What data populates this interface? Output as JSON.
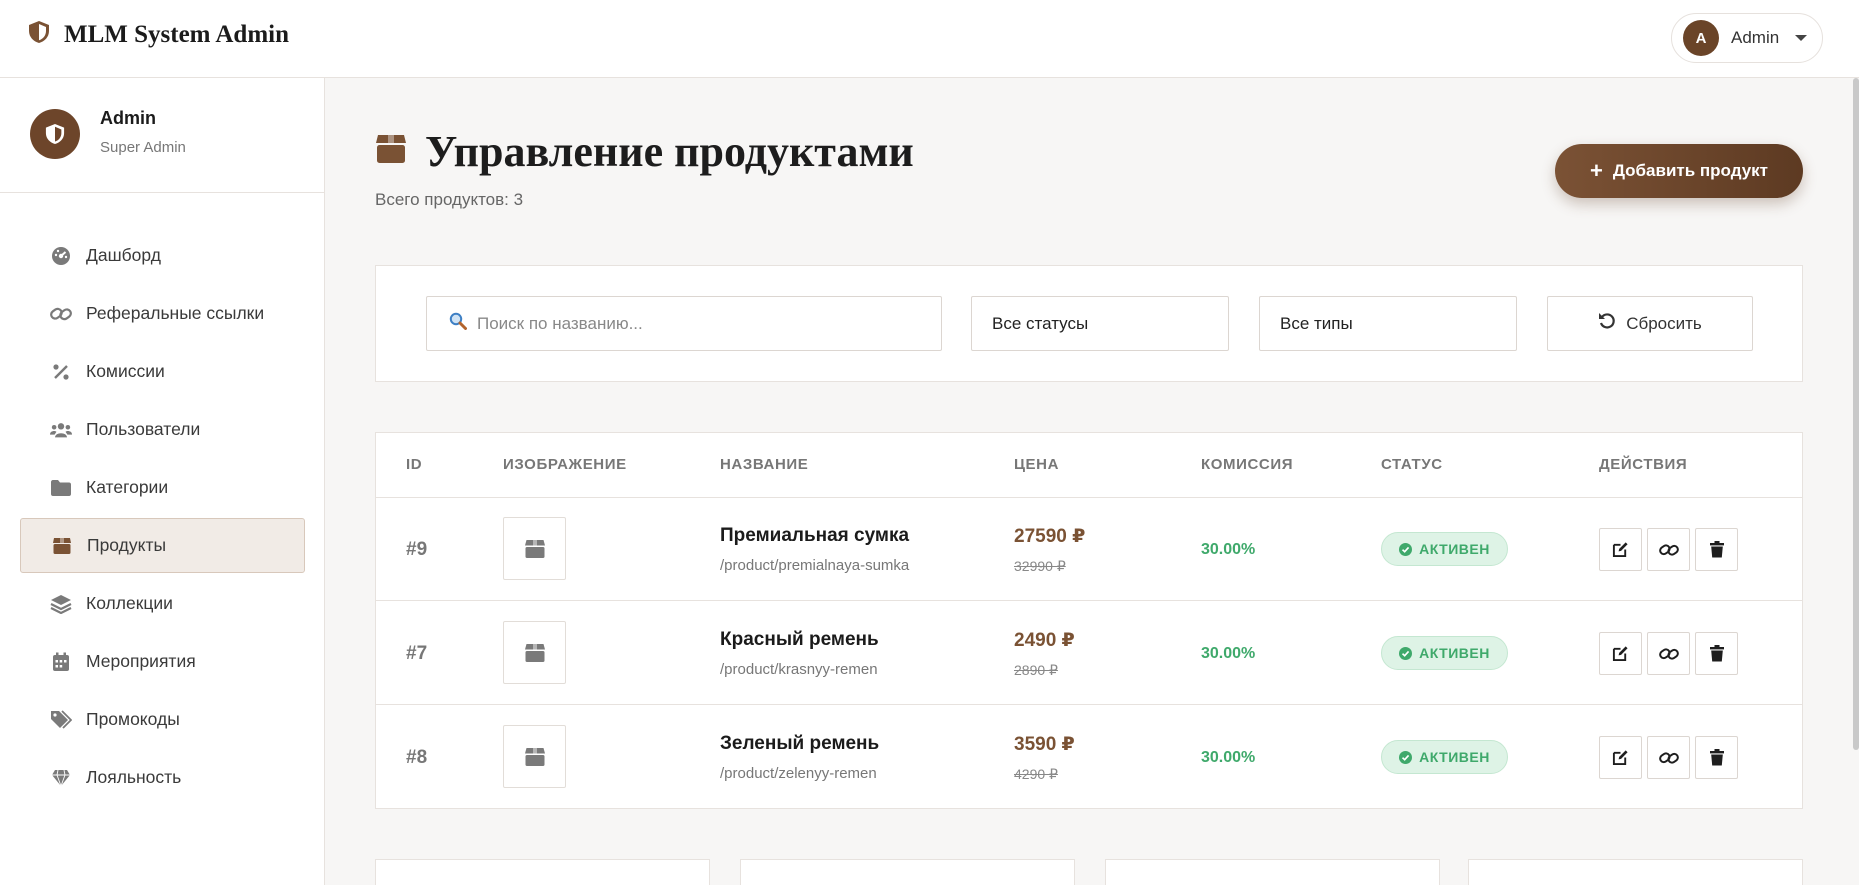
{
  "app": {
    "title": "MLM System Admin"
  },
  "header": {
    "user_initial": "A",
    "user_name": "Admin"
  },
  "sidebar": {
    "profile": {
      "name": "Admin",
      "role": "Super Admin"
    },
    "items": [
      {
        "label": "Дашборд",
        "icon": "dashboard-icon",
        "active": false
      },
      {
        "label": "Реферальные ссылки",
        "icon": "link-icon",
        "active": false
      },
      {
        "label": "Комиссии",
        "icon": "percent-icon",
        "active": false
      },
      {
        "label": "Пользователи",
        "icon": "users-icon",
        "active": false
      },
      {
        "label": "Категории",
        "icon": "folder-icon",
        "active": false
      },
      {
        "label": "Продукты",
        "icon": "box-icon",
        "active": true
      },
      {
        "label": "Коллекции",
        "icon": "layers-icon",
        "active": false
      },
      {
        "label": "Мероприятия",
        "icon": "calendar-icon",
        "active": false
      },
      {
        "label": "Промокоды",
        "icon": "tags-icon",
        "active": false
      },
      {
        "label": "Лояльность",
        "icon": "gem-icon",
        "active": false
      }
    ]
  },
  "page": {
    "title": "Управление продуктами",
    "subtitle": "Всего продуктов: 3",
    "add_button": "Добавить продукт"
  },
  "filters": {
    "search_placeholder": "Поиск по названию...",
    "search_value": "",
    "status_selected": "Все статусы",
    "type_selected": "Все типы",
    "reset_label": "Сбросить"
  },
  "table": {
    "columns": [
      "ID",
      "ИЗОБРАЖЕНИЕ",
      "НАЗВАНИЕ",
      "ЦЕНА",
      "КОМИССИЯ",
      "СТАТУС",
      "ДЕЙСТВИЯ"
    ],
    "rows": [
      {
        "id": "#9",
        "name": "Премиальная сумка",
        "slug": "/product/premialnaya-sumka",
        "price": "27590 ₽",
        "old_price": "32990 ₽",
        "commission": "30.00%",
        "status": "АКТИВЕН"
      },
      {
        "id": "#7",
        "name": "Красный ремень",
        "slug": "/product/krasnyy-remen",
        "price": "2490 ₽",
        "old_price": "2890 ₽",
        "commission": "30.00%",
        "status": "АКТИВЕН"
      },
      {
        "id": "#8",
        "name": "Зеленый ремень",
        "slug": "/product/zelenyy-remen",
        "price": "3590 ₽",
        "old_price": "4290 ₽",
        "commission": "30.00%",
        "status": "АКТИВЕН"
      }
    ]
  },
  "colors": {
    "accent": "#6d452a",
    "price": "#7a5234",
    "success": "#3fa96b",
    "muted_icon": "#7a7a7a"
  }
}
